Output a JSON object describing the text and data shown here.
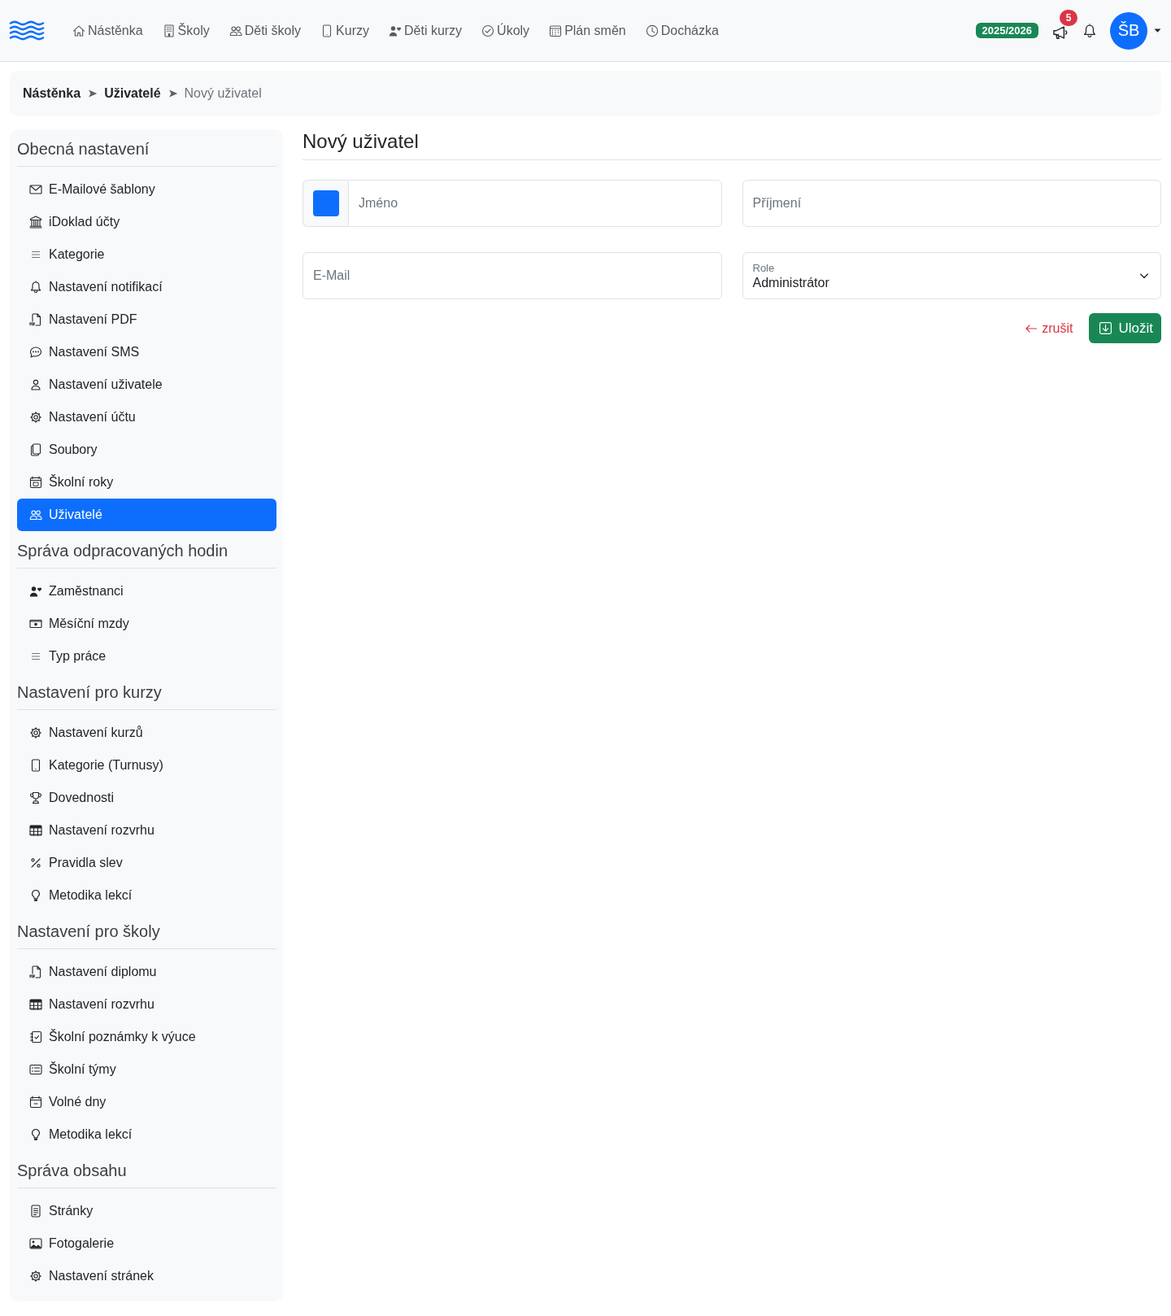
{
  "navbar": {
    "items": [
      {
        "label": "Nástěnka",
        "selected": false
      },
      {
        "label": "Školy",
        "selected": false
      },
      {
        "label": "Děti školy",
        "selected": false
      },
      {
        "label": "Kurzy",
        "selected": false
      },
      {
        "label": "Děti kurzy",
        "selected": false
      },
      {
        "label": "Úkoly",
        "selected": false
      },
      {
        "label": "Plán směn",
        "selected": false
      },
      {
        "label": "Docházka",
        "selected": false
      }
    ],
    "school_year": "2025/2026",
    "announcements_count": "5",
    "avatar_initials": "ŠB"
  },
  "breadcrumb": [
    "Nástěnka",
    "Uživatelé",
    "Nový uživatel"
  ],
  "sidebar": {
    "sections": [
      {
        "title": "Obecná nastavení",
        "items": [
          {
            "label": "E-Mailové šablony",
            "selected": false
          },
          {
            "label": "iDoklad účty",
            "selected": false
          },
          {
            "label": "Kategorie",
            "selected": false
          },
          {
            "label": "Nastavení notifikací",
            "selected": false
          },
          {
            "label": "Nastavení PDF",
            "selected": false
          },
          {
            "label": "Nastavení SMS",
            "selected": false
          },
          {
            "label": "Nastavení uživatele",
            "selected": false
          },
          {
            "label": "Nastavení účtu",
            "selected": false
          },
          {
            "label": "Soubory",
            "selected": false
          },
          {
            "label": "Školní roky",
            "selected": false
          },
          {
            "label": "Uživatelé",
            "selected": true
          }
        ]
      },
      {
        "title": "Správa odpracovaných hodin",
        "items": [
          {
            "label": "Zaměstnanci",
            "selected": false
          },
          {
            "label": "Měsíční mzdy",
            "selected": false
          },
          {
            "label": "Typ práce",
            "selected": false
          }
        ]
      },
      {
        "title": "Nastavení pro kurzy",
        "items": [
          {
            "label": "Nastavení kurzů",
            "selected": false
          },
          {
            "label": "Kategorie (Turnusy)",
            "selected": false
          },
          {
            "label": "Dovednosti",
            "selected": false
          },
          {
            "label": "Nastavení rozvrhu",
            "selected": false
          },
          {
            "label": "Pravidla slev",
            "selected": false
          },
          {
            "label": "Metodika lekcí",
            "selected": false
          }
        ]
      },
      {
        "title": "Nastavení pro školy",
        "items": [
          {
            "label": "Nastavení diplomu",
            "selected": false
          },
          {
            "label": "Nastavení rozvrhu",
            "selected": false
          },
          {
            "label": "Školní poznámky k výuce",
            "selected": false
          },
          {
            "label": "Školní týmy",
            "selected": false
          },
          {
            "label": "Volné dny",
            "selected": false
          },
          {
            "label": "Metodika lekcí",
            "selected": false
          }
        ]
      },
      {
        "title": "Správa obsahu",
        "items": [
          {
            "label": "Stránky",
            "selected": false
          },
          {
            "label": "Fotogalerie",
            "selected": false
          },
          {
            "label": "Nastavení stránek",
            "selected": false
          }
        ]
      }
    ]
  },
  "form": {
    "title": "Nový uživatel",
    "fields": [
      {
        "kind": "color_text",
        "placeholder": "Jméno",
        "color": "#0d6efd"
      },
      {
        "kind": "text",
        "placeholder": "Příjmení"
      },
      {
        "kind": "text",
        "placeholder": "E-Mail"
      },
      {
        "kind": "select",
        "label": "Role",
        "value": "Administrátor"
      }
    ],
    "cancel": "zrušit",
    "save": "Uložit"
  }
}
